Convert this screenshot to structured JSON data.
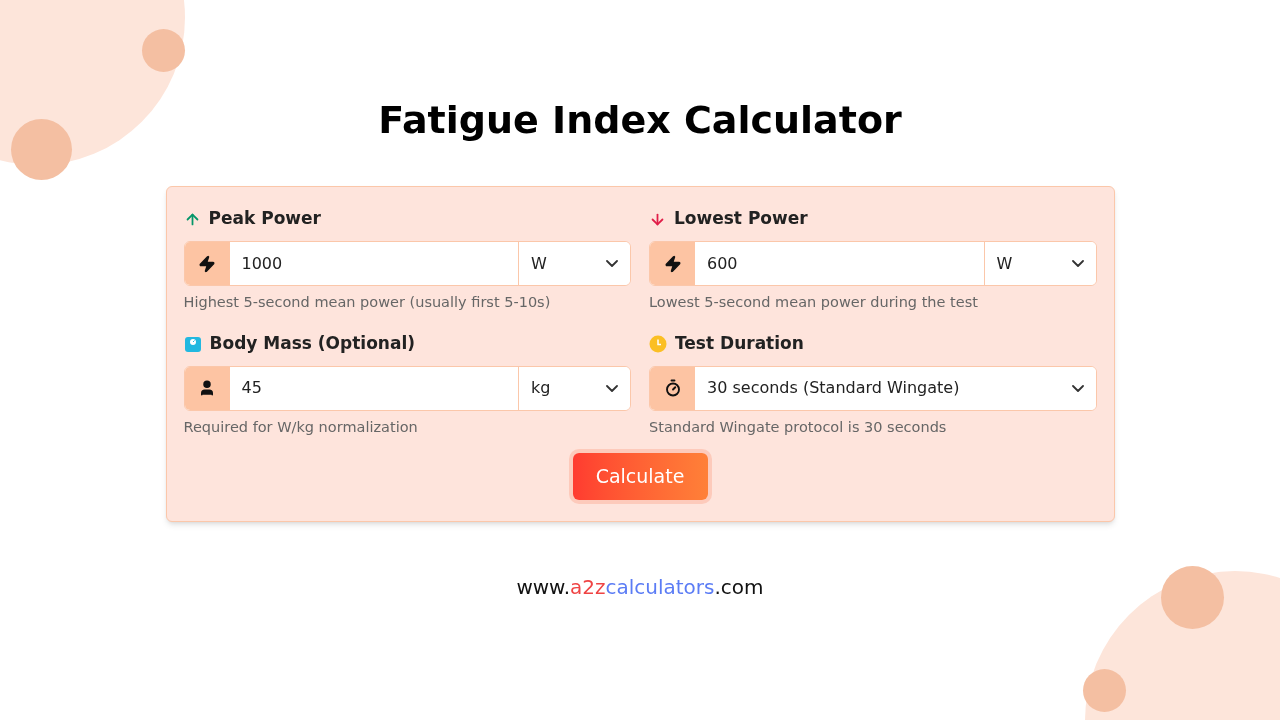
{
  "title": "Fatigue Index Calculator",
  "fields": [
    {
      "kind": "input",
      "label": "Peak Power",
      "value": "1000",
      "unit": "W",
      "help": "Highest 5-second mean power (usually first 5-10s)"
    },
    {
      "kind": "input",
      "label": "Lowest Power",
      "value": "600",
      "unit": "W",
      "help": "Lowest 5-second mean power during the test"
    },
    {
      "kind": "input",
      "label": "Body Mass (Optional)",
      "value": "45",
      "unit": "kg",
      "help": "Required for W/kg normalization"
    },
    {
      "kind": "select",
      "label": "Test Duration",
      "value": "30 seconds (Standard Wingate)",
      "help": "Standard Wingate protocol is 30 seconds"
    }
  ],
  "button": "Calculate",
  "footer": [
    {
      "text": "www.",
      "color": "#111111"
    },
    {
      "text": "a2z",
      "color": "#ef4444"
    },
    {
      "text": "calculators",
      "color": "#5b7cf5"
    },
    {
      "text": ".com",
      "color": "#111111"
    }
  ]
}
